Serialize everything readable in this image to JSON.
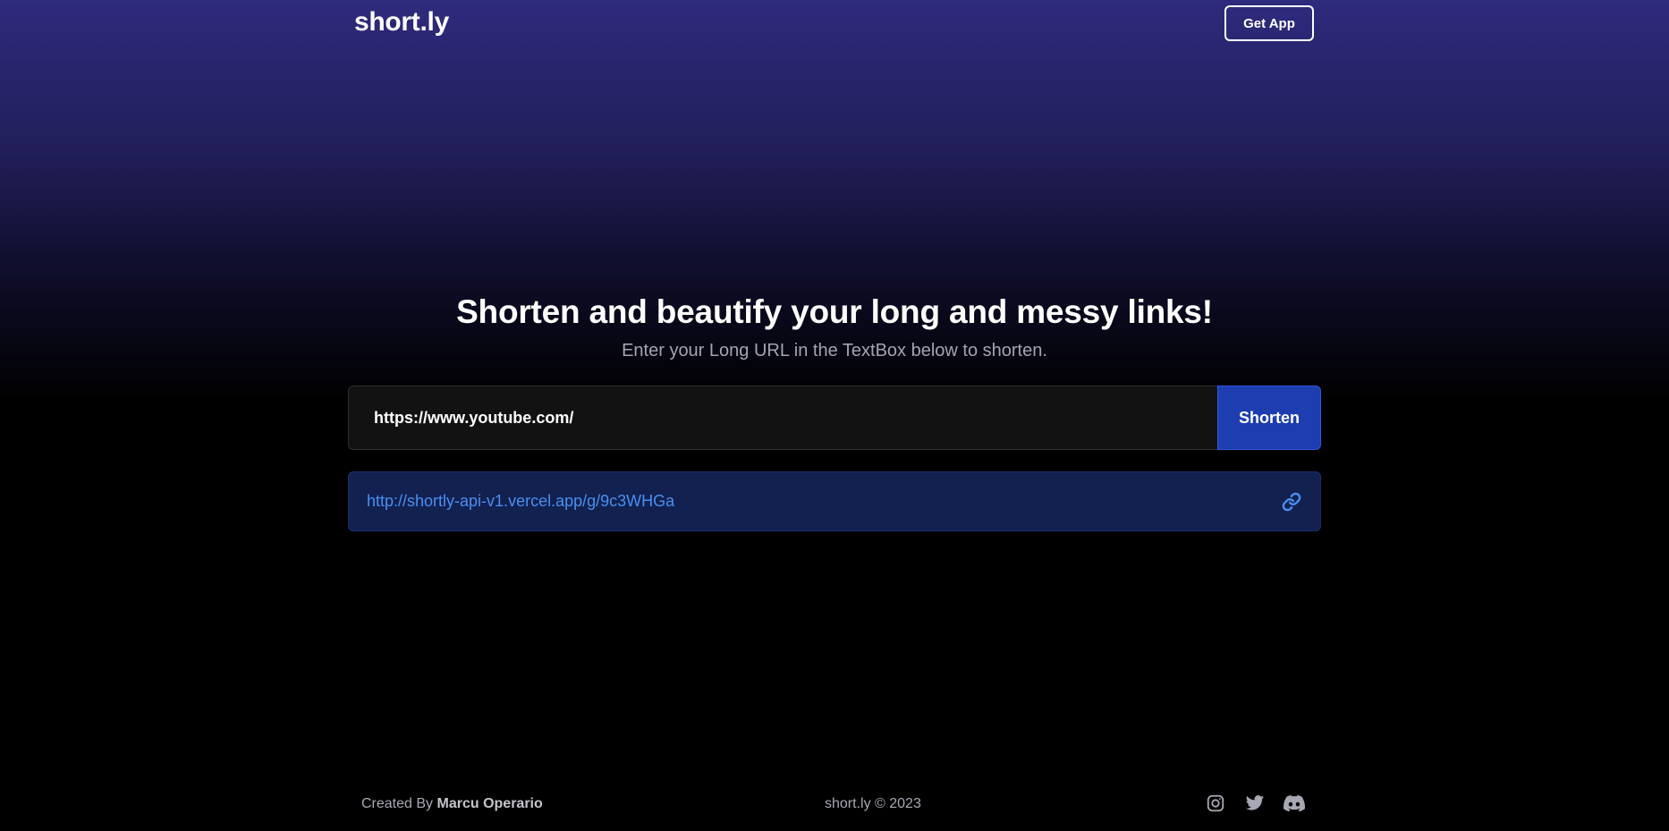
{
  "header": {
    "logo": "short.ly",
    "get_app_label": "Get App"
  },
  "hero": {
    "title": "Shorten and beautify your long and messy links!",
    "subtitle": "Enter your Long URL in the TextBox below to shorten."
  },
  "form": {
    "url_value": "https://www.youtube.com/",
    "shorten_label": "Shorten"
  },
  "result": {
    "short_url": "http://shortly-api-v1.vercel.app/g/9c3WHGa",
    "icon": "link-icon"
  },
  "footer": {
    "created_by_prefix": "Created By",
    "author": "Marcu Operario",
    "copyright": "short.ly © 2023",
    "socials": [
      "instagram-icon",
      "twitter-icon",
      "discord-icon"
    ]
  },
  "colors": {
    "accent": "#1d3db0",
    "link": "#4b8ef0",
    "result_bg": "#122150",
    "gradient_top": "#2f2a7c"
  }
}
